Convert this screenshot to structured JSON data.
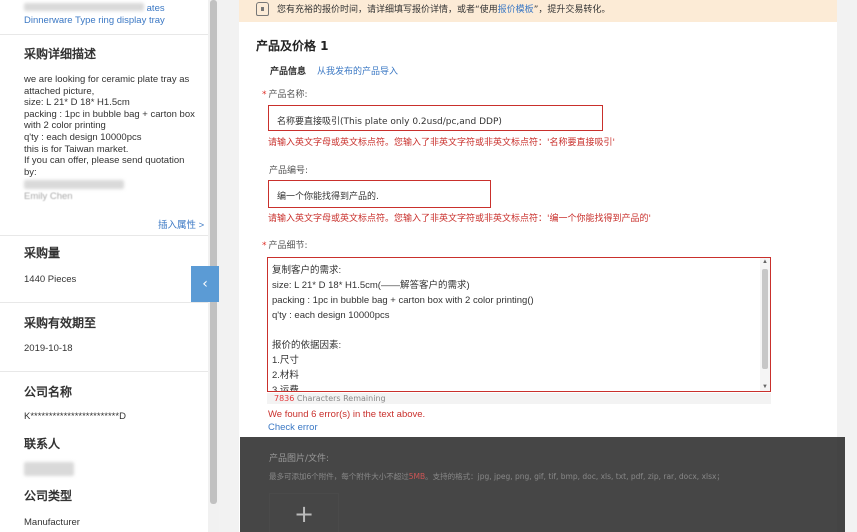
{
  "sidebar": {
    "top_link": "Dinnerware Type ring display tray",
    "top_link_partial": "ates",
    "detail_heading": "采购详细描述",
    "detail_lines": [
      "we are looking for ceramic plate tray as",
      "attached picture,",
      "size: L 21* D 18* H1.5cm",
      "packing : 1pc in bubble bag + carton box",
      "with 2 color printing",
      "q'ty : each design 10000pcs",
      "this is for Taiwan market.",
      "If you can offer, please send quotation",
      "by:"
    ],
    "signature_partial": "Emily Chen",
    "insert_attr": "插入属性 >",
    "qty_heading": "采购量",
    "qty_value": "1440 Pieces",
    "expiry_heading": "采购有效期至",
    "expiry_value": "2019-10-18",
    "company_heading": "公司名称",
    "company_value": "K************************D",
    "contact_heading": "联系人",
    "company_type_heading": "公司类型",
    "company_type_value": "Manufacturer",
    "toggle_icon": "‹"
  },
  "notice": {
    "text_before": "您有充裕的报价时间，请详细填写报价详情，或者“使用",
    "link": "报价模板",
    "text_after": "”，提升交易转化。"
  },
  "section": {
    "title": "产品及价格 1",
    "tab_active": "产品信息",
    "tab_link": "从我发布的产品导入"
  },
  "product_name": {
    "label": "产品名称:",
    "value": "名称要直接吸引(This plate only 0.2usd/pc,and DDP)",
    "error": "请输入英文字母或英文标点符。您输入了非英文字符或非英文标点符：'名称要直接吸引'"
  },
  "product_code": {
    "label": "产品编号:",
    "value": "编一个你能找得到产品的.",
    "error": "请输入英文字母或英文标点符。您输入了非英文字符或非英文标点符：'编一个你能找得到产品的'"
  },
  "product_detail": {
    "label": "产品细节:",
    "lines": [
      "复制客户的需求:",
      "size: L 21* D 18* H1.5cm(——解答客户的需求)",
      "packing : 1pc in bubble bag + carton box with 2 color printing()",
      "q'ty : each design 10000pcs",
      "",
      "报价的依据因素:",
      "1.尺寸",
      "2.材料",
      "3.运费"
    ],
    "chars_remaining_num": "7836",
    "chars_remaining_text": " Characters Remaining",
    "error_summary": "We found 6 error(s) in the text above.",
    "check_error": "Check error"
  },
  "attachments": {
    "label": "产品图片/文件:",
    "hint_before": "最多可添加6个附件，每个附件大小不超过",
    "hint_size": "5MB",
    "hint_after": "。支持的格式：jpg, jpeg, png, gif, tif, bmp, doc, xls, txt, pdf, zip, rar, docx, xlsx；",
    "add_icon": "+"
  },
  "colors": {
    "error_red": "#c9302c",
    "link_blue": "#3b78c4",
    "notice_bg": "#fcebd6",
    "toggle_blue": "#5b9bd5"
  }
}
